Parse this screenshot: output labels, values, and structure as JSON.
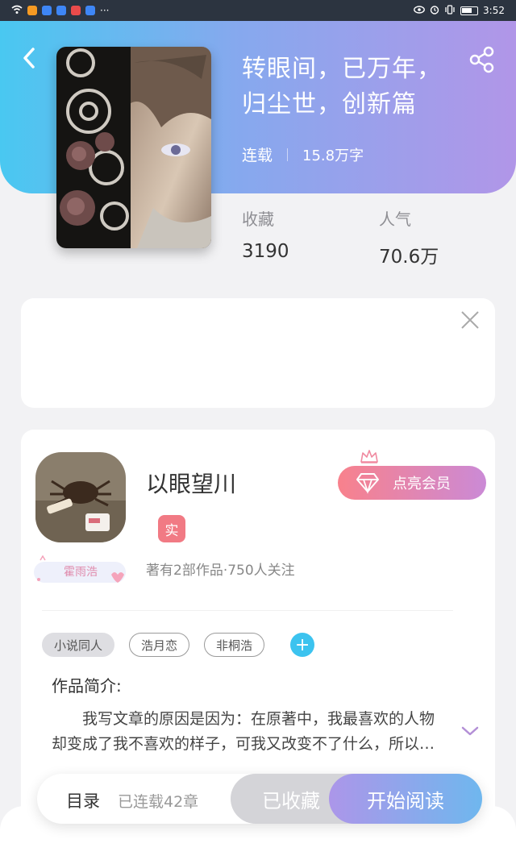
{
  "status_bar": {
    "time": "3:52",
    "left_more": "···",
    "app_icon_colors": [
      "#f59a23",
      "#3e86f5",
      "#3e86f5",
      "#e94b4b",
      "#3e86f5"
    ]
  },
  "book": {
    "title": "转眼间，已万年，归尘世，创新篇",
    "status": "连载",
    "word_count": "15.8万字"
  },
  "stats": {
    "favorites_label": "收藏",
    "favorites_value": "3190",
    "popularity_label": "人气",
    "popularity_value": "70.6万"
  },
  "author": {
    "name": "以眼望川",
    "verified_label": "实",
    "fan_badge_text": "霍雨浩",
    "stats_text": "著有2部作品·750人关注",
    "vip_button_label": "点亮会员"
  },
  "tags": [
    "小说同人",
    "浩月恋",
    "非桐浩"
  ],
  "tag_add_label": "+",
  "intro": {
    "title": "作品简介:",
    "text": "我写文章的原因是因为：在原著中，我最喜欢的人物却变成了我不喜欢的样子，可我又改变不了什么，所以我写了这篇文章。"
  },
  "action_bar": {
    "toc_label": "目录",
    "chapter_count": "已连载42章",
    "collected_label": "已收藏",
    "read_label": "开始阅读"
  },
  "colors": {
    "header_gradient_start": "#49c8f1",
    "header_gradient_end": "#b196e8",
    "vip_gradient_start": "#f8818c",
    "vip_gradient_end": "#cb8ad6",
    "accent_blue": "#3cc3ef"
  },
  "icons": {
    "back": "chevron-left-icon",
    "share": "share-icon",
    "close": "close-icon",
    "expand": "chevron-down-icon",
    "diamond": "diamond-icon",
    "crown": "crown-icon"
  }
}
